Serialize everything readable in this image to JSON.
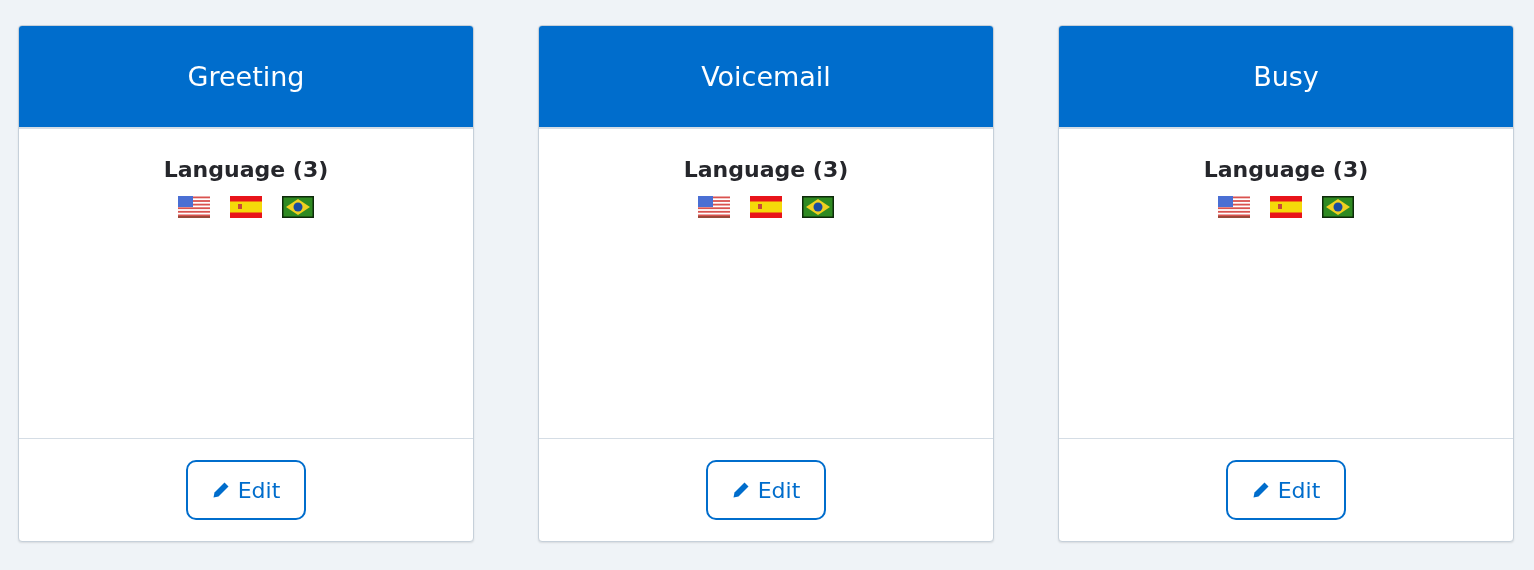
{
  "cards": [
    {
      "title": "Greeting",
      "language_label": "Language (3)",
      "flags": [
        {
          "kind": "us"
        },
        {
          "kind": "es"
        },
        {
          "kind": "br"
        }
      ],
      "button": "Edit"
    },
    {
      "title": "Voicemail",
      "language_label": "Language (3)",
      "flags": [
        {
          "kind": "us"
        },
        {
          "kind": "es"
        },
        {
          "kind": "br"
        }
      ],
      "button": "Edit"
    },
    {
      "title": "Busy",
      "language_label": "Language (3)",
      "flags": [
        {
          "kind": "us"
        },
        {
          "kind": "es"
        },
        {
          "kind": "br"
        }
      ],
      "button": "Edit"
    }
  ]
}
